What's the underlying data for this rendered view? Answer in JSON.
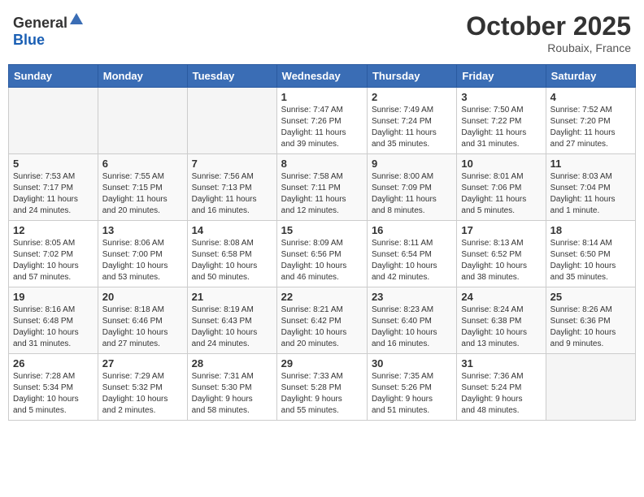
{
  "header": {
    "logo_general": "General",
    "logo_blue": "Blue",
    "month": "October 2025",
    "location": "Roubaix, France"
  },
  "weekdays": [
    "Sunday",
    "Monday",
    "Tuesday",
    "Wednesday",
    "Thursday",
    "Friday",
    "Saturday"
  ],
  "weeks": [
    [
      {
        "day": "",
        "info": ""
      },
      {
        "day": "",
        "info": ""
      },
      {
        "day": "",
        "info": ""
      },
      {
        "day": "1",
        "info": "Sunrise: 7:47 AM\nSunset: 7:26 PM\nDaylight: 11 hours\nand 39 minutes."
      },
      {
        "day": "2",
        "info": "Sunrise: 7:49 AM\nSunset: 7:24 PM\nDaylight: 11 hours\nand 35 minutes."
      },
      {
        "day": "3",
        "info": "Sunrise: 7:50 AM\nSunset: 7:22 PM\nDaylight: 11 hours\nand 31 minutes."
      },
      {
        "day": "4",
        "info": "Sunrise: 7:52 AM\nSunset: 7:20 PM\nDaylight: 11 hours\nand 27 minutes."
      }
    ],
    [
      {
        "day": "5",
        "info": "Sunrise: 7:53 AM\nSunset: 7:17 PM\nDaylight: 11 hours\nand 24 minutes."
      },
      {
        "day": "6",
        "info": "Sunrise: 7:55 AM\nSunset: 7:15 PM\nDaylight: 11 hours\nand 20 minutes."
      },
      {
        "day": "7",
        "info": "Sunrise: 7:56 AM\nSunset: 7:13 PM\nDaylight: 11 hours\nand 16 minutes."
      },
      {
        "day": "8",
        "info": "Sunrise: 7:58 AM\nSunset: 7:11 PM\nDaylight: 11 hours\nand 12 minutes."
      },
      {
        "day": "9",
        "info": "Sunrise: 8:00 AM\nSunset: 7:09 PM\nDaylight: 11 hours\nand 8 minutes."
      },
      {
        "day": "10",
        "info": "Sunrise: 8:01 AM\nSunset: 7:06 PM\nDaylight: 11 hours\nand 5 minutes."
      },
      {
        "day": "11",
        "info": "Sunrise: 8:03 AM\nSunset: 7:04 PM\nDaylight: 11 hours\nand 1 minute."
      }
    ],
    [
      {
        "day": "12",
        "info": "Sunrise: 8:05 AM\nSunset: 7:02 PM\nDaylight: 10 hours\nand 57 minutes."
      },
      {
        "day": "13",
        "info": "Sunrise: 8:06 AM\nSunset: 7:00 PM\nDaylight: 10 hours\nand 53 minutes."
      },
      {
        "day": "14",
        "info": "Sunrise: 8:08 AM\nSunset: 6:58 PM\nDaylight: 10 hours\nand 50 minutes."
      },
      {
        "day": "15",
        "info": "Sunrise: 8:09 AM\nSunset: 6:56 PM\nDaylight: 10 hours\nand 46 minutes."
      },
      {
        "day": "16",
        "info": "Sunrise: 8:11 AM\nSunset: 6:54 PM\nDaylight: 10 hours\nand 42 minutes."
      },
      {
        "day": "17",
        "info": "Sunrise: 8:13 AM\nSunset: 6:52 PM\nDaylight: 10 hours\nand 38 minutes."
      },
      {
        "day": "18",
        "info": "Sunrise: 8:14 AM\nSunset: 6:50 PM\nDaylight: 10 hours\nand 35 minutes."
      }
    ],
    [
      {
        "day": "19",
        "info": "Sunrise: 8:16 AM\nSunset: 6:48 PM\nDaylight: 10 hours\nand 31 minutes."
      },
      {
        "day": "20",
        "info": "Sunrise: 8:18 AM\nSunset: 6:46 PM\nDaylight: 10 hours\nand 27 minutes."
      },
      {
        "day": "21",
        "info": "Sunrise: 8:19 AM\nSunset: 6:43 PM\nDaylight: 10 hours\nand 24 minutes."
      },
      {
        "day": "22",
        "info": "Sunrise: 8:21 AM\nSunset: 6:42 PM\nDaylight: 10 hours\nand 20 minutes."
      },
      {
        "day": "23",
        "info": "Sunrise: 8:23 AM\nSunset: 6:40 PM\nDaylight: 10 hours\nand 16 minutes."
      },
      {
        "day": "24",
        "info": "Sunrise: 8:24 AM\nSunset: 6:38 PM\nDaylight: 10 hours\nand 13 minutes."
      },
      {
        "day": "25",
        "info": "Sunrise: 8:26 AM\nSunset: 6:36 PM\nDaylight: 10 hours\nand 9 minutes."
      }
    ],
    [
      {
        "day": "26",
        "info": "Sunrise: 7:28 AM\nSunset: 5:34 PM\nDaylight: 10 hours\nand 5 minutes."
      },
      {
        "day": "27",
        "info": "Sunrise: 7:29 AM\nSunset: 5:32 PM\nDaylight: 10 hours\nand 2 minutes."
      },
      {
        "day": "28",
        "info": "Sunrise: 7:31 AM\nSunset: 5:30 PM\nDaylight: 9 hours\nand 58 minutes."
      },
      {
        "day": "29",
        "info": "Sunrise: 7:33 AM\nSunset: 5:28 PM\nDaylight: 9 hours\nand 55 minutes."
      },
      {
        "day": "30",
        "info": "Sunrise: 7:35 AM\nSunset: 5:26 PM\nDaylight: 9 hours\nand 51 minutes."
      },
      {
        "day": "31",
        "info": "Sunrise: 7:36 AM\nSunset: 5:24 PM\nDaylight: 9 hours\nand 48 minutes."
      },
      {
        "day": "",
        "info": ""
      }
    ]
  ]
}
